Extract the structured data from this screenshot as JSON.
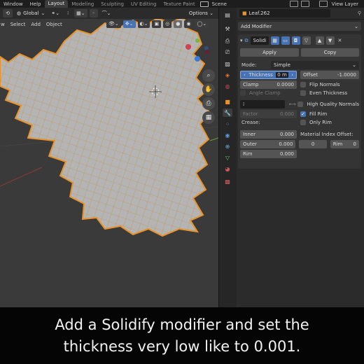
{
  "topbar": {
    "menus": [
      "Window",
      "Help"
    ],
    "workspaces": [
      "Layout",
      "Modeling",
      "Sculpting",
      "UV Editing",
      "Texture Paint"
    ],
    "active_workspace": "Layout",
    "scene": "Scene",
    "view_layer": "View Layer"
  },
  "viewport": {
    "orientation": "Global",
    "options": "Options",
    "menu": [
      "w",
      "Select",
      "Add",
      "Object"
    ]
  },
  "properties": {
    "object_name": "Leaf.262",
    "add_modifier": "Add Modifier",
    "modifier_name": "Solidi",
    "apply": "Apply",
    "copy": "Copy",
    "mode_label": "Mode:",
    "mode_value": "Simple",
    "thickness_label": "Thickness",
    "thickness_value": "0 m",
    "offset_label": "Offset",
    "offset_value": "-1.0000",
    "clamp_label": "Clamp",
    "clamp_value": "0.0000",
    "angle_clamp": "Angle Clamp",
    "factor_label": "Factor",
    "factor_value": "0.000",
    "flip_normals": "Flip Normals",
    "even_thickness": "Even Thickness",
    "high_quality_normals": "High Quality Normals",
    "fill_rim": "Fill Rim",
    "only_rim": "Only Rim",
    "crease_label": "Crease:",
    "inner_label": "Inner",
    "inner_value": "0.000",
    "outer_label": "Outer",
    "outer_value": "0.000",
    "rim_label": "Rim",
    "rim_value": "0.000",
    "mat_offset_label": "Material Index Offset:",
    "mat_offset_value": "0",
    "mat_rim_label": "Rim",
    "mat_rim_value": "0"
  },
  "caption": {
    "line1": "Add a Solidify modifier and set the",
    "line2": "thickness very low like to 0.001."
  },
  "colors": {
    "mesh_fill": "#b5b5b5",
    "mesh_outline": "#e8932a",
    "active_blue": "#4772b3",
    "viewport_bg": "#3a3a3a"
  }
}
